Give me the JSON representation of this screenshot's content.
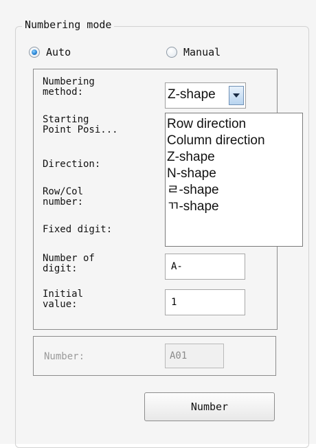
{
  "group": {
    "title": "Numbering mode"
  },
  "mode": {
    "auto_label": "Auto",
    "manual_label": "Manual",
    "selected": "Auto"
  },
  "fields": {
    "numbering_method_label": "Numbering\nmethod:",
    "starting_point_label": "Starting\nPoint Posi...",
    "direction_label": "Direction:",
    "row_col_label": "Row/Col\nnumber:",
    "fixed_digit_label": "Fixed digit:",
    "number_of_digit_label": "Number of\ndigit:",
    "number_of_digit_value": "A-",
    "initial_value_label": "Initial\nvalue:",
    "initial_value_value": "1"
  },
  "numbering_method": {
    "selected": "Z-shape",
    "options": [
      "Row direction",
      "Column direction",
      "Z-shape",
      "N-shape",
      "ㄹ-shape",
      "ㄲ-shape"
    ]
  },
  "number_panel": {
    "label": "Number:",
    "value": "A01"
  },
  "actions": {
    "number_button": "Number"
  },
  "icons": {
    "combo_arrow": "chevron-down-icon"
  },
  "colors": {
    "accent": "#2a86d6",
    "combo_button": "#b8d4ef"
  }
}
